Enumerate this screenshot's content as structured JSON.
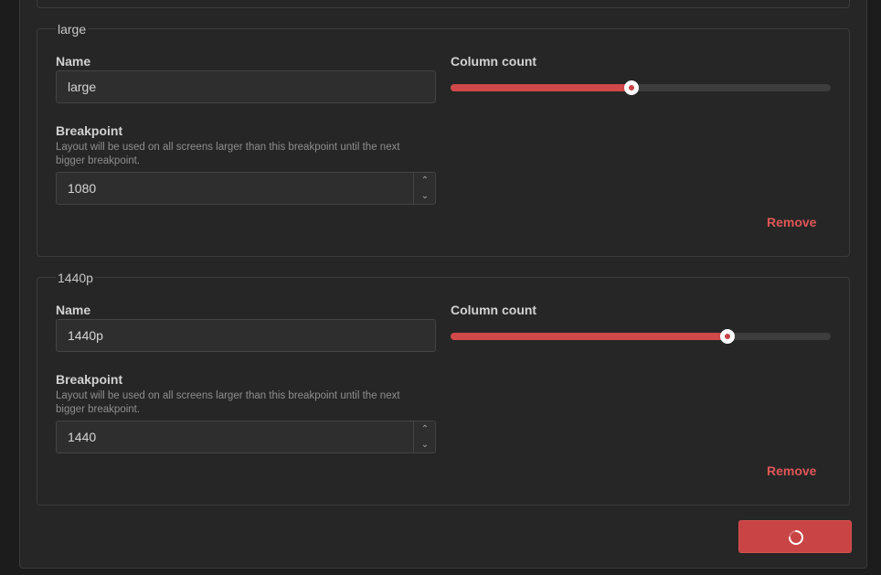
{
  "breakpoints": [
    {
      "legend": "large",
      "name_label": "Name",
      "name_value": "large",
      "column_label": "Column count",
      "column_fraction": 0.477,
      "breakpoint_label": "Breakpoint",
      "breakpoint_help": "Layout will be used on all screens larger than this breakpoint until the next bigger breakpoint.",
      "breakpoint_value": "1080",
      "remove_label": "Remove"
    },
    {
      "legend": "1440p",
      "name_label": "Name",
      "name_value": "1440p",
      "column_label": "Column count",
      "column_fraction": 0.728,
      "breakpoint_label": "Breakpoint",
      "breakpoint_help": "Layout will be used on all screens larger than this breakpoint until the next bigger breakpoint.",
      "breakpoint_value": "1440",
      "remove_label": "Remove"
    }
  ],
  "icons": {
    "spin_up": "chevron-up-icon",
    "spin_down": "chevron-down-icon",
    "loader": "loading-spinner-icon"
  },
  "colors": {
    "accent": "#d04848",
    "remove": "#e05656",
    "background": "#262626"
  }
}
